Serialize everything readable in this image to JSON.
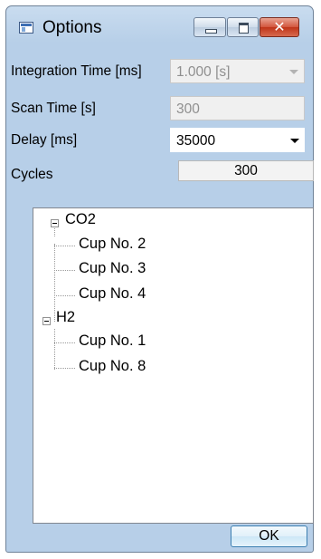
{
  "window": {
    "title": "Options",
    "close_glyph": "✕"
  },
  "form": {
    "integration_time": {
      "label": "Integration Time [ms]",
      "value": "1.000 [s]",
      "enabled": false
    },
    "scan_time": {
      "label": "Scan Time [s]",
      "value": "300",
      "enabled": false
    },
    "delay": {
      "label": "Delay [ms]",
      "value": "35000",
      "enabled": true
    },
    "cycles": {
      "label": "Cycles",
      "value": "300"
    }
  },
  "tree": {
    "groups": [
      {
        "label": "CO2",
        "expanded": true,
        "children": [
          "Cup No. 2",
          "Cup No. 3",
          "Cup No. 4"
        ]
      },
      {
        "label": "H2",
        "expanded": true,
        "children": [
          "Cup No. 1",
          "Cup No. 8"
        ]
      }
    ]
  },
  "buttons": {
    "ok_label": "OK"
  }
}
